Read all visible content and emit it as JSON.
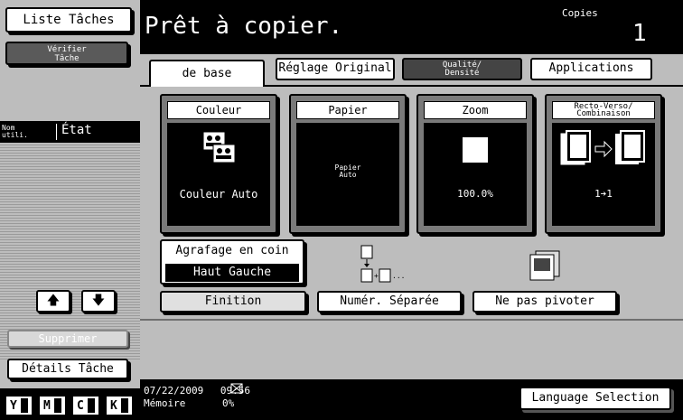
{
  "left": {
    "liste_taches": "Liste Tâches",
    "verifier_tache": "Vérifier\nTâche",
    "col_nom": "Nom\nutili.",
    "col_etat": "État",
    "supprimer": "Supprimer",
    "details": "Détails Tâche",
    "toners": [
      {
        "label": "Y",
        "level": 0.9
      },
      {
        "label": "M",
        "level": 0.9
      },
      {
        "label": "C",
        "level": 0.9
      },
      {
        "label": "K",
        "level": 0.9
      }
    ]
  },
  "header": {
    "title": "Prêt à copier.",
    "copies_label": "Copies",
    "copies_count": "1"
  },
  "tabs": [
    {
      "label": "de base"
    },
    {
      "label": "Réglage Original"
    },
    {
      "label": "Qualité/\nDensité"
    },
    {
      "label": "Applications"
    }
  ],
  "functions": {
    "couleur": {
      "title": "Couleur",
      "value": "Couleur Auto"
    },
    "papier": {
      "title": "Papier",
      "value": "Papier\nAuto"
    },
    "zoom": {
      "title": "Zoom",
      "value": "100.0%"
    },
    "recto": {
      "title": "Recto-Verso/\nCombinaison",
      "value": "1➔1"
    }
  },
  "finishing": {
    "agrafage_title": "Agrafage en coin",
    "agrafage_value": "Haut Gauche",
    "finition": "Finition",
    "numer_separee": "Numér. Séparée",
    "pivoter": "Ne pas pivoter"
  },
  "status": {
    "date": "07/22/2009",
    "time": "09:56",
    "memoire_label": "Mémoire",
    "memoire_value": "0%",
    "language": "Language Selection"
  }
}
